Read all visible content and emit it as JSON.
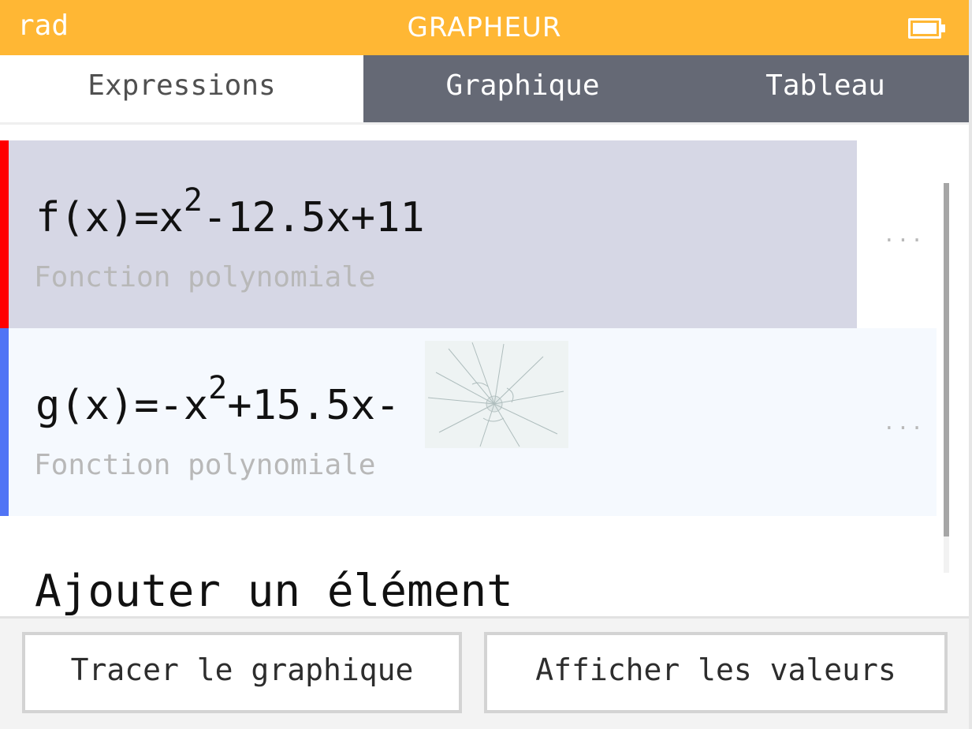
{
  "statusbar": {
    "angle_mode": "rad",
    "app_title": "GRAPHEUR",
    "battery_icon": "battery-full-icon",
    "background_color": "#ffb734"
  },
  "tabs": [
    {
      "label": "Expressions",
      "active": true
    },
    {
      "label": "Graphique",
      "active": false
    },
    {
      "label": "Tableau",
      "active": false
    }
  ],
  "expressions": [
    {
      "name": "f(x)",
      "lhs": "f(x)=x",
      "exponent": "2",
      "rhs": "-12.5x+11",
      "type_label": "Fonction polynomiale",
      "color": "#ff0000",
      "selected": true,
      "more_label": "..."
    },
    {
      "name": "g(x)",
      "lhs": "g(x)=-x",
      "exponent": "2",
      "rhs": "+15.5x-",
      "type_label": "Fonction polynomiale",
      "color": "#5174f5",
      "selected": false,
      "more_label": "..."
    }
  ],
  "add_element_label": "Ajouter un élément",
  "buttons": {
    "plot": "Tracer le graphique",
    "values": "Afficher les valeurs"
  }
}
